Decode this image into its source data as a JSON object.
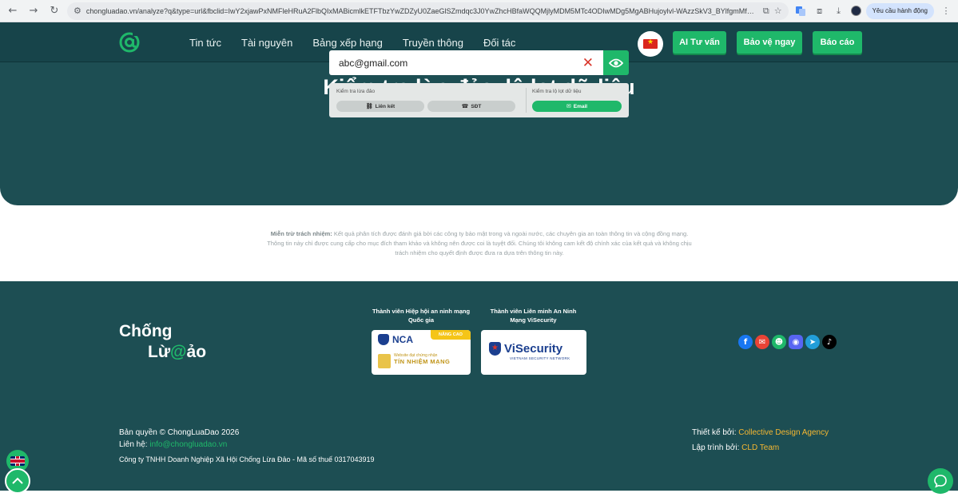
{
  "browser": {
    "url": "chongluadao.vn/analyze?q&type=url&fbclid=IwY2xjawPxNMFleHRuA2FlbQIxMABicmlkETFTbzYwZDZyU0ZaeGlSZmdqc3J0YwZhcHBfaWQQMjlyMDM5MTc4ODIwMDg5MgABHujoylvl-WAzzSkV3_BYlfgmMfXmmbXZfq1...",
    "request_button": "Yêu cầu hành động"
  },
  "nav": {
    "items": [
      "Tin tức",
      "Tài nguyên",
      "Bảng xếp hạng",
      "Truyền thông",
      "Đối tác"
    ],
    "buttons": {
      "ai": "AI Tư vấn",
      "protect": "Bảo vệ ngay",
      "report": "Báo cáo"
    }
  },
  "hero": {
    "title": "Kiểm tra lừa đảo, lộ lọt dữ liệu",
    "search_value": "abc@gmail.com",
    "fraud_label": "Kiểm tra lừa đảo",
    "leak_label": "Kiểm tra lộ lọt dữ liệu",
    "options": {
      "link": "Liên kết",
      "phone": "SĐT",
      "email": "Email"
    }
  },
  "disclaimer": {
    "label": "Miễn trừ trách nhiệm:",
    "text": "Kết quả phân tích được đánh giá bởi các công ty bảo mật trong và ngoài nước, các chuyên gia an toàn thông tin và cộng đồng mạng. Thông tin này chỉ được cung cấp cho mục đích tham khảo và không nên được coi là tuyệt đối. Chúng tôi không cam kết độ chính xác của kết quả và không chịu trách nhiệm cho quyết định được đưa ra dựa trên thông tin này."
  },
  "footer": {
    "logo_line1": "Chống",
    "logo_line2a": "Lừ",
    "logo_at": "@",
    "logo_line2b": "ảo",
    "member1": "Thành viên Hiệp hội an ninh mạng Quốc gia",
    "member2": "Thành viên Liên minh An Ninh Mạng ViSecurity",
    "nca": {
      "tag": "NÂNG CAO",
      "name": "NCA",
      "sub_small": "Website đạt chứng nhận",
      "sub_big": "TÍN NHIỆM MẠNG"
    },
    "visecurity": {
      "name": "ViSecurity",
      "sub": "VIETNAM SECURITY NETWORK"
    },
    "copyright": "Bản quyền © ChongLuaDao 2026",
    "contact_label": "Liên hệ:",
    "contact_email": "info@chongluadao.vn",
    "company": "Công ty TNHH Doanh Nghiệp Xã Hội Chống Lừa Đảo - Mã số thuế 0317043919",
    "design_label": "Thiết kế bởi:",
    "design_value": "Collective Design Agency",
    "dev_label": "Lập trình bởi:",
    "dev_value": "CLD Team"
  },
  "colors": {
    "header": "#17444a",
    "hero": "#1d4e53",
    "accent": "#1fb86a",
    "highlight": "#f5b731"
  },
  "icons": [
    "back-icon",
    "forward-icon",
    "reload-icon",
    "site-info-icon",
    "translate-icon",
    "star-icon",
    "extensions-icon",
    "download-icon",
    "close-x-icon",
    "eye-icon",
    "link-icon",
    "phone-icon",
    "mail-icon",
    "facebook-icon",
    "email-icon",
    "group-icon",
    "discord-icon",
    "telegram-icon",
    "tiktok-icon",
    "uk-flag-icon",
    "vietnam-flag-icon",
    "chevron-up-icon",
    "chat-icon"
  ]
}
